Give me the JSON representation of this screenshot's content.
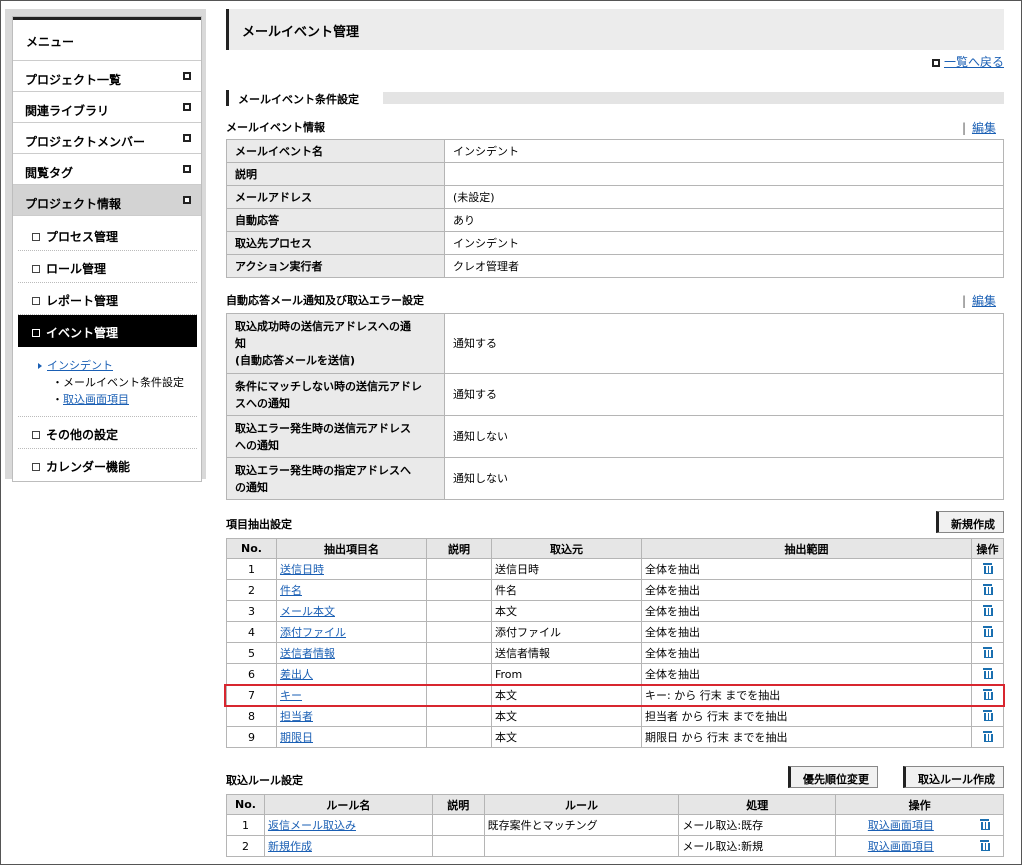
{
  "sidebar": {
    "header": "メニュー",
    "items": [
      {
        "label": "プロジェクト一覧"
      },
      {
        "label": "関連ライブラリ"
      },
      {
        "label": "プロジェクトメンバー"
      },
      {
        "label": "閲覧タグ"
      },
      {
        "label": "プロジェクト情報"
      }
    ],
    "sub_items": [
      {
        "label": "プロセス管理"
      },
      {
        "label": "ロール管理"
      },
      {
        "label": "レポート管理"
      },
      {
        "label": "イベント管理"
      }
    ],
    "tree": {
      "parent": "インシデント",
      "children": [
        "・メールイベント条件設定",
        "・取込画面項目"
      ]
    },
    "sub_items_after": [
      {
        "label": "その他の設定"
      },
      {
        "label": "カレンダー機能"
      }
    ]
  },
  "page": {
    "title": "メールイベント管理",
    "back_link": "一覧へ戻る",
    "section_title": "メールイベント条件設定",
    "edit_label": "編集"
  },
  "mail_event_info": {
    "title": "メールイベント情報",
    "rows": [
      {
        "key": "メールイベント名",
        "value": "インシデント"
      },
      {
        "key": "説明",
        "value": ""
      },
      {
        "key": "メールアドレス",
        "value": "(未設定)"
      },
      {
        "key": "自動応答",
        "value": "あり"
      },
      {
        "key": "取込先プロセス",
        "value": "インシデント"
      },
      {
        "key": "アクション実行者",
        "value": "クレオ管理者"
      }
    ]
  },
  "auto_reply": {
    "title": "自動応答メール通知及び取込エラー設定",
    "rows": [
      {
        "key": "取込成功時の送信元アドレスへの通知\n(自動応答メールを送信)",
        "value": "通知する"
      },
      {
        "key": "条件にマッチしない時の送信元アドレスへの通知",
        "value": "通知する"
      },
      {
        "key": "取込エラー発生時の送信元アドレスへの通知",
        "value": "通知しない"
      },
      {
        "key": "取込エラー発生時の指定アドレスへの通知",
        "value": "通知しない"
      }
    ]
  },
  "extract": {
    "title": "項目抽出設定",
    "new_button": "新規作成",
    "headers": [
      "No.",
      "抽出項目名",
      "説明",
      "取込元",
      "抽出範囲",
      "操作"
    ],
    "rows": [
      {
        "no": "1",
        "name": "送信日時",
        "desc": "",
        "source": "送信日時",
        "range": "全体を抽出"
      },
      {
        "no": "2",
        "name": "件名",
        "desc": "",
        "source": "件名",
        "range": "全体を抽出"
      },
      {
        "no": "3",
        "name": "メール本文",
        "desc": "",
        "source": "本文",
        "range": "全体を抽出"
      },
      {
        "no": "4",
        "name": "添付ファイル",
        "desc": "",
        "source": "添付ファイル",
        "range": "全体を抽出"
      },
      {
        "no": "5",
        "name": "送信者情報",
        "desc": "",
        "source": "送信者情報",
        "range": "全体を抽出"
      },
      {
        "no": "6",
        "name": "差出人",
        "desc": "",
        "source": "From",
        "range": "全体を抽出"
      },
      {
        "no": "7",
        "name": "キー",
        "desc": "",
        "source": "本文",
        "range": "キー: から 行末 までを抽出"
      },
      {
        "no": "8",
        "name": "担当者",
        "desc": "",
        "source": "本文",
        "range": "担当者 から 行末 までを抽出"
      },
      {
        "no": "9",
        "name": "期限日",
        "desc": "",
        "source": "本文",
        "range": "期限日 から 行末 までを抽出"
      }
    ]
  },
  "rules": {
    "title": "取込ルール設定",
    "priority_button": "優先順位変更",
    "create_button": "取込ルール作成",
    "headers": [
      "No.",
      "ルール名",
      "説明",
      "ルール",
      "処理",
      "操作"
    ],
    "rows": [
      {
        "no": "1",
        "name": "返信メール取込み",
        "desc": "",
        "rule": "既存案件とマッチング",
        "process": "メール取込:既存",
        "link": "取込画面項目"
      },
      {
        "no": "2",
        "name": "新規作成",
        "desc": "",
        "rule": "",
        "process": "メール取込:新規",
        "link": "取込画面項目"
      }
    ]
  },
  "colors": {
    "highlight": "#d8262f",
    "link": "#1a5fb4",
    "active_bg": "#000000"
  }
}
